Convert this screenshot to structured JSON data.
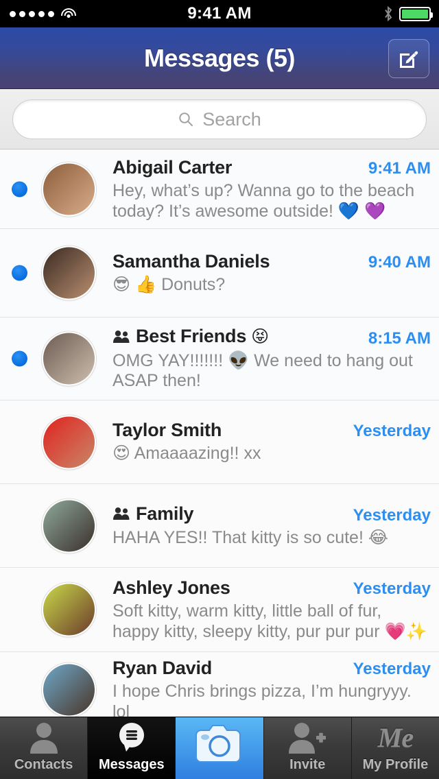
{
  "statusbar": {
    "time": "9:41 AM",
    "signal_dots": 5,
    "wifi_icon": "wifi-icon",
    "bluetooth_icon": "bluetooth-icon",
    "battery_icon": "battery-icon",
    "battery_color": "#4cd964"
  },
  "navbar": {
    "title": "Messages (5)",
    "compose_icon": "compose-icon",
    "gradient_from": "#2c4ba6",
    "gradient_to": "#4b4273"
  },
  "search": {
    "placeholder": "Search",
    "value": "",
    "icon": "search-icon"
  },
  "colors": {
    "accent_blue": "#2d8ef0",
    "unread_dot": "#0b6fe0",
    "name_text": "#222222",
    "preview_text": "#8a8a8a"
  },
  "conversations": [
    {
      "name": "Abigail Carter",
      "time": "9:41 AM",
      "preview": "Hey, what’s up? Wanna go to the beach today? It’s awesome outside! 💙 💜",
      "unread": true,
      "group": false,
      "avatar_name": "avatar-abigail-carter",
      "avatar_colors": [
        "#8d5f3c",
        "#d8ab8a"
      ]
    },
    {
      "name": "Samantha Daniels",
      "time": "9:40 AM",
      "preview": "😎 👍 Donuts?",
      "unread": true,
      "group": false,
      "avatar_name": "avatar-samantha-daniels",
      "avatar_colors": [
        "#3a2a22",
        "#b98f70"
      ]
    },
    {
      "name": "Best Friends",
      "time": "8:15 AM",
      "name_suffix_emoji": "😝",
      "preview": "OMG YAY!!!!!!! 👽 We need to hang out ASAP then!",
      "unread": true,
      "group": true,
      "avatar_name": "avatar-best-friends",
      "avatar_colors": [
        "#6c5b52",
        "#cdbfae"
      ]
    },
    {
      "name": "Taylor Smith",
      "time": "Yesterday",
      "preview": "😍 Amaaaazing!! xx",
      "unread": false,
      "group": false,
      "avatar_name": "avatar-taylor-smith",
      "avatar_colors": [
        "#e0231f",
        "#c9876a"
      ]
    },
    {
      "name": "Family",
      "time": "Yesterday",
      "preview": "HAHA YES!! That kitty is so cute! 😂",
      "unread": false,
      "group": true,
      "avatar_name": "avatar-family",
      "avatar_colors": [
        "#8fa99b",
        "#3a2f2a"
      ]
    },
    {
      "name": "Ashley Jones",
      "time": "Yesterday",
      "preview": "Soft kitty, warm kitty, little ball of fur, happy kitty, sleepy kitty, pur pur pur 💗✨",
      "unread": false,
      "group": false,
      "avatar_name": "avatar-ashley-jones",
      "avatar_colors": [
        "#c9d94a",
        "#6b3a2b"
      ]
    },
    {
      "name": "Ryan David",
      "time": "Yesterday",
      "preview": "I hope Chris brings pizza, I’m hungryyy. lol",
      "unread": false,
      "group": false,
      "avatar_name": "avatar-ryan-david",
      "avatar_colors": [
        "#6ea8c9",
        "#4a3528"
      ]
    }
  ],
  "tabbar": {
    "items": [
      {
        "label": "Contacts",
        "icon": "contacts-person-icon",
        "state": "inactive"
      },
      {
        "label": "Messages",
        "icon": "message-bubble-icon",
        "state": "active"
      },
      {
        "label": "",
        "icon": "camera-icon",
        "state": "camera"
      },
      {
        "label": "Invite",
        "icon": "add-person-icon",
        "state": "inactive"
      },
      {
        "label": "My Profile",
        "icon": "me-logo-icon",
        "state": "inactive",
        "logo_text": "Me"
      }
    ]
  }
}
